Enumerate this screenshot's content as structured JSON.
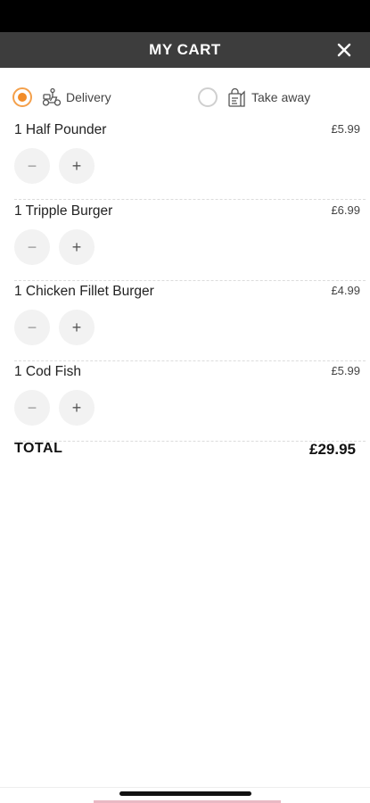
{
  "header": {
    "title": "MY CART",
    "close_icon": "close-icon"
  },
  "order_type": {
    "selected": "delivery",
    "options": [
      {
        "label": "Delivery",
        "icon": "delivery-scooter-icon"
      },
      {
        "label": "Take away",
        "icon": "take-away-bag-icon"
      }
    ]
  },
  "cart": {
    "items": [
      {
        "name": "1 Half Pounder",
        "price": "£5.99",
        "minus": "−",
        "plus": "+"
      },
      {
        "name": "1 Tripple Burger",
        "price": "£6.99",
        "minus": "−",
        "plus": "+"
      },
      {
        "name": "1 Chicken Fillet Burger",
        "price": "£4.99",
        "minus": "−",
        "plus": "+"
      },
      {
        "name": "1 Cod Fish",
        "price": "£5.99",
        "minus": "−",
        "plus": "+"
      }
    ],
    "total_label": "TOTAL",
    "total_amount": "£29.95"
  },
  "colors": {
    "header_bg": "#3d3d3d",
    "accent": "#f28c28"
  }
}
